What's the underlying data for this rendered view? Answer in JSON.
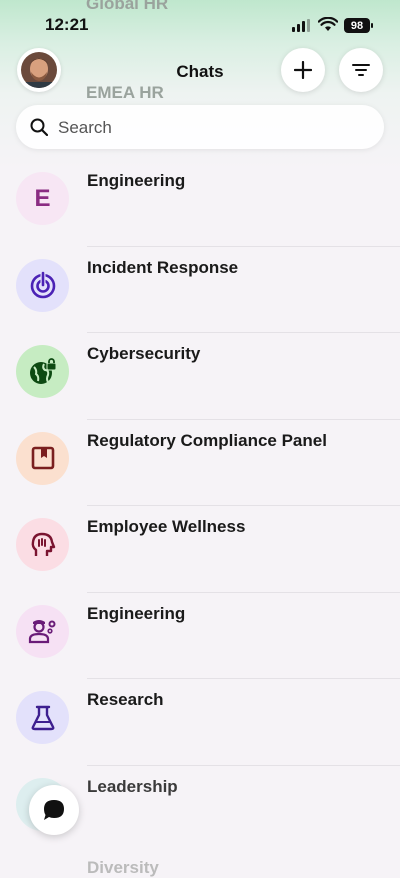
{
  "status_bar": {
    "time": "12:21",
    "battery": "98"
  },
  "background_titles": [
    "Global HR",
    "EMEA HR"
  ],
  "header": {
    "title": "Chats",
    "add_icon": "plus-icon",
    "filter_icon": "filter-icon"
  },
  "search": {
    "placeholder": "Search",
    "value": ""
  },
  "chats": [
    {
      "name": "Engineering",
      "avatar": "letter",
      "letter": "E",
      "bg": "#f7e6f4",
      "fg": "#8a2c82"
    },
    {
      "name": "Incident Response",
      "avatar": "power-target-icon",
      "bg": "#e3e1fb",
      "fg": "#4b22b5"
    },
    {
      "name": "Cybersecurity",
      "avatar": "globe-lock-icon",
      "bg": "#c6ecc2",
      "fg": "#0d4a12"
    },
    {
      "name": "Regulatory Compliance Panel",
      "avatar": "book-icon",
      "bg": "#fbe0cf",
      "fg": "#7a1f1f"
    },
    {
      "name": "Employee Wellness",
      "avatar": "head-icon",
      "bg": "#fbdde4",
      "fg": "#7a1430"
    },
    {
      "name": "Engineering",
      "avatar": "engineer-icon",
      "bg": "#f6e1f4",
      "fg": "#6a1c78"
    },
    {
      "name": "Research",
      "avatar": "flask-icon",
      "bg": "#e3e1fb",
      "fg": "#3d1f8f"
    },
    {
      "name": "Leadership",
      "avatar": "teal",
      "bg": "#d9eeee",
      "fg": "#1a6b6b"
    }
  ],
  "partial_last": "Diversity",
  "fab": {
    "icon": "chat-bubble-icon"
  },
  "colors": {
    "background": "#f6f3f7",
    "accent_green": "#bfe7cd"
  }
}
